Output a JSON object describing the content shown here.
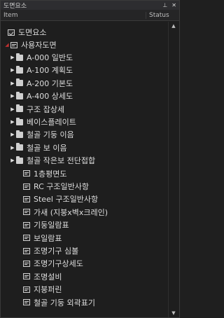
{
  "panel": {
    "title": "도면요소",
    "pin_glyph": "⊥",
    "close_glyph": "✕"
  },
  "columns": {
    "item": "Item",
    "status": "Status"
  },
  "tree": {
    "root": {
      "label": "도면요소",
      "icon": "check-icon"
    },
    "user_drawings": {
      "label": "사용자도면",
      "icon": "sheet-icon",
      "expanded": true
    },
    "folders": [
      {
        "label": "A-000 일반도"
      },
      {
        "label": "A-100 계획도"
      },
      {
        "label": "A-200 기본도"
      },
      {
        "label": "A-400 상세도"
      },
      {
        "label": "구조 잡상세"
      },
      {
        "label": "베이스플레이트"
      },
      {
        "label": "철골 기둥 이음"
      },
      {
        "label": "철골 보 이음"
      },
      {
        "label": "철골 작은보 전단접합"
      }
    ],
    "sheets": [
      {
        "label": "1층평면도"
      },
      {
        "label": "RC 구조일반사항"
      },
      {
        "label": "Steel 구조일반사항"
      },
      {
        "label": "가새 (지붕x벽x크레인)"
      },
      {
        "label": "기둥일람표"
      },
      {
        "label": "보일람표"
      },
      {
        "label": "조명기구 심볼"
      },
      {
        "label": "조명기구상세도"
      },
      {
        "label": "조명설비"
      },
      {
        "label": "지붕퍼린"
      },
      {
        "label": "철골 기둥 외곽표기"
      }
    ]
  },
  "scrollbar": {
    "up_glyph": "▲",
    "down_glyph": "▼"
  }
}
